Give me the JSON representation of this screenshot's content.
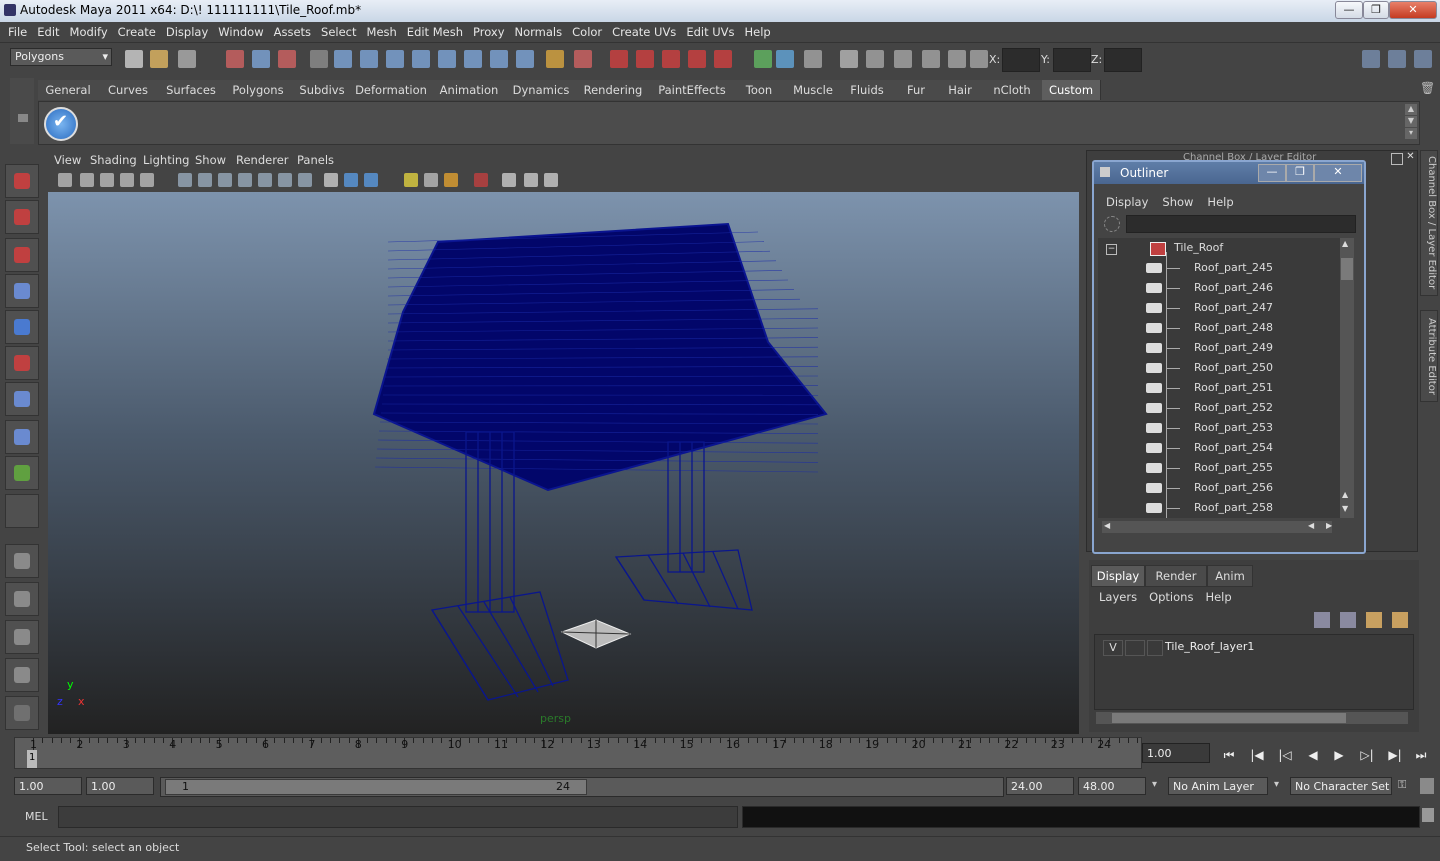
{
  "window": {
    "title": "Autodesk Maya 2011 x64: D:\\! 111111111\\Tile_Roof.mb*",
    "min_glyph": "—",
    "max_glyph": "❐",
    "close_glyph": "✕"
  },
  "menubar": {
    "items": [
      "File",
      "Edit",
      "Modify",
      "Create",
      "Display",
      "Window",
      "Assets",
      "Select",
      "Mesh",
      "Edit Mesh",
      "Proxy",
      "Normals",
      "Color",
      "Create UVs",
      "Edit UVs",
      "Help"
    ]
  },
  "statusline": {
    "mode": "Polygons",
    "x_label": "X:",
    "y_label": "Y:",
    "z_label": "Z:"
  },
  "shelf": {
    "tabs": [
      "General",
      "Curves",
      "Surfaces",
      "Polygons",
      "Subdivs",
      "Deformation",
      "Animation",
      "Dynamics",
      "Rendering",
      "PaintEffects",
      "Toon",
      "Muscle",
      "Fluids",
      "Fur",
      "Hair",
      "nCloth",
      "Custom"
    ],
    "active_tab": "Custom"
  },
  "viewport": {
    "menu": [
      "View",
      "Shading",
      "Lighting",
      "Show",
      "Renderer",
      "Panels"
    ],
    "camera_label": "persp",
    "axis_y": "y",
    "axis_x": "x",
    "axis_z": "z",
    "wire_color": "#000c80"
  },
  "outliner": {
    "title": "Outliner",
    "menu": [
      "Display",
      "Show",
      "Help"
    ],
    "expand_glyph": "−",
    "root": "Tile_Roof",
    "items": [
      "Roof_part_245",
      "Roof_part_246",
      "Roof_part_247",
      "Roof_part_248",
      "Roof_part_249",
      "Roof_part_250",
      "Roof_part_251",
      "Roof_part_252",
      "Roof_part_253",
      "Roof_part_254",
      "Roof_part_255",
      "Roof_part_256",
      "Roof_part_258"
    ]
  },
  "channel_box": {
    "title": "Channel Box / Layer Editor"
  },
  "right_tabs": {
    "channel_box": "Channel Box / Layer Editor",
    "attribute_editor": "Attribute Editor"
  },
  "layer_editor": {
    "tabs": [
      "Display",
      "Render",
      "Anim"
    ],
    "active_tab": "Display",
    "menu": [
      "Layers",
      "Options",
      "Help"
    ],
    "layers": [
      {
        "visible": "V",
        "name": "Tile_Roof_layer1"
      }
    ]
  },
  "time_slider": {
    "ticks": [
      "1",
      "2",
      "3",
      "4",
      "5",
      "6",
      "7",
      "8",
      "9",
      "10",
      "11",
      "12",
      "13",
      "14",
      "15",
      "16",
      "17",
      "18",
      "19",
      "20",
      "21",
      "22",
      "23",
      "24"
    ],
    "current_marker": "1",
    "current_frame": "1.00"
  },
  "playback": {
    "buttons": [
      "⏮",
      "|◀",
      "|◁",
      "◀",
      "▶",
      "▷|",
      "▶|",
      "⏭"
    ]
  },
  "range_slider": {
    "start_time": "1.00",
    "playback_start": "1.00",
    "range_start": "1",
    "range_end": "24",
    "playback_end": "24.00",
    "end_time": "48.00",
    "anim_layer": "No Anim Layer",
    "character_set": "No Character Set"
  },
  "command_line": {
    "label": "MEL"
  },
  "help_line": {
    "text": "Select Tool: select an object"
  }
}
